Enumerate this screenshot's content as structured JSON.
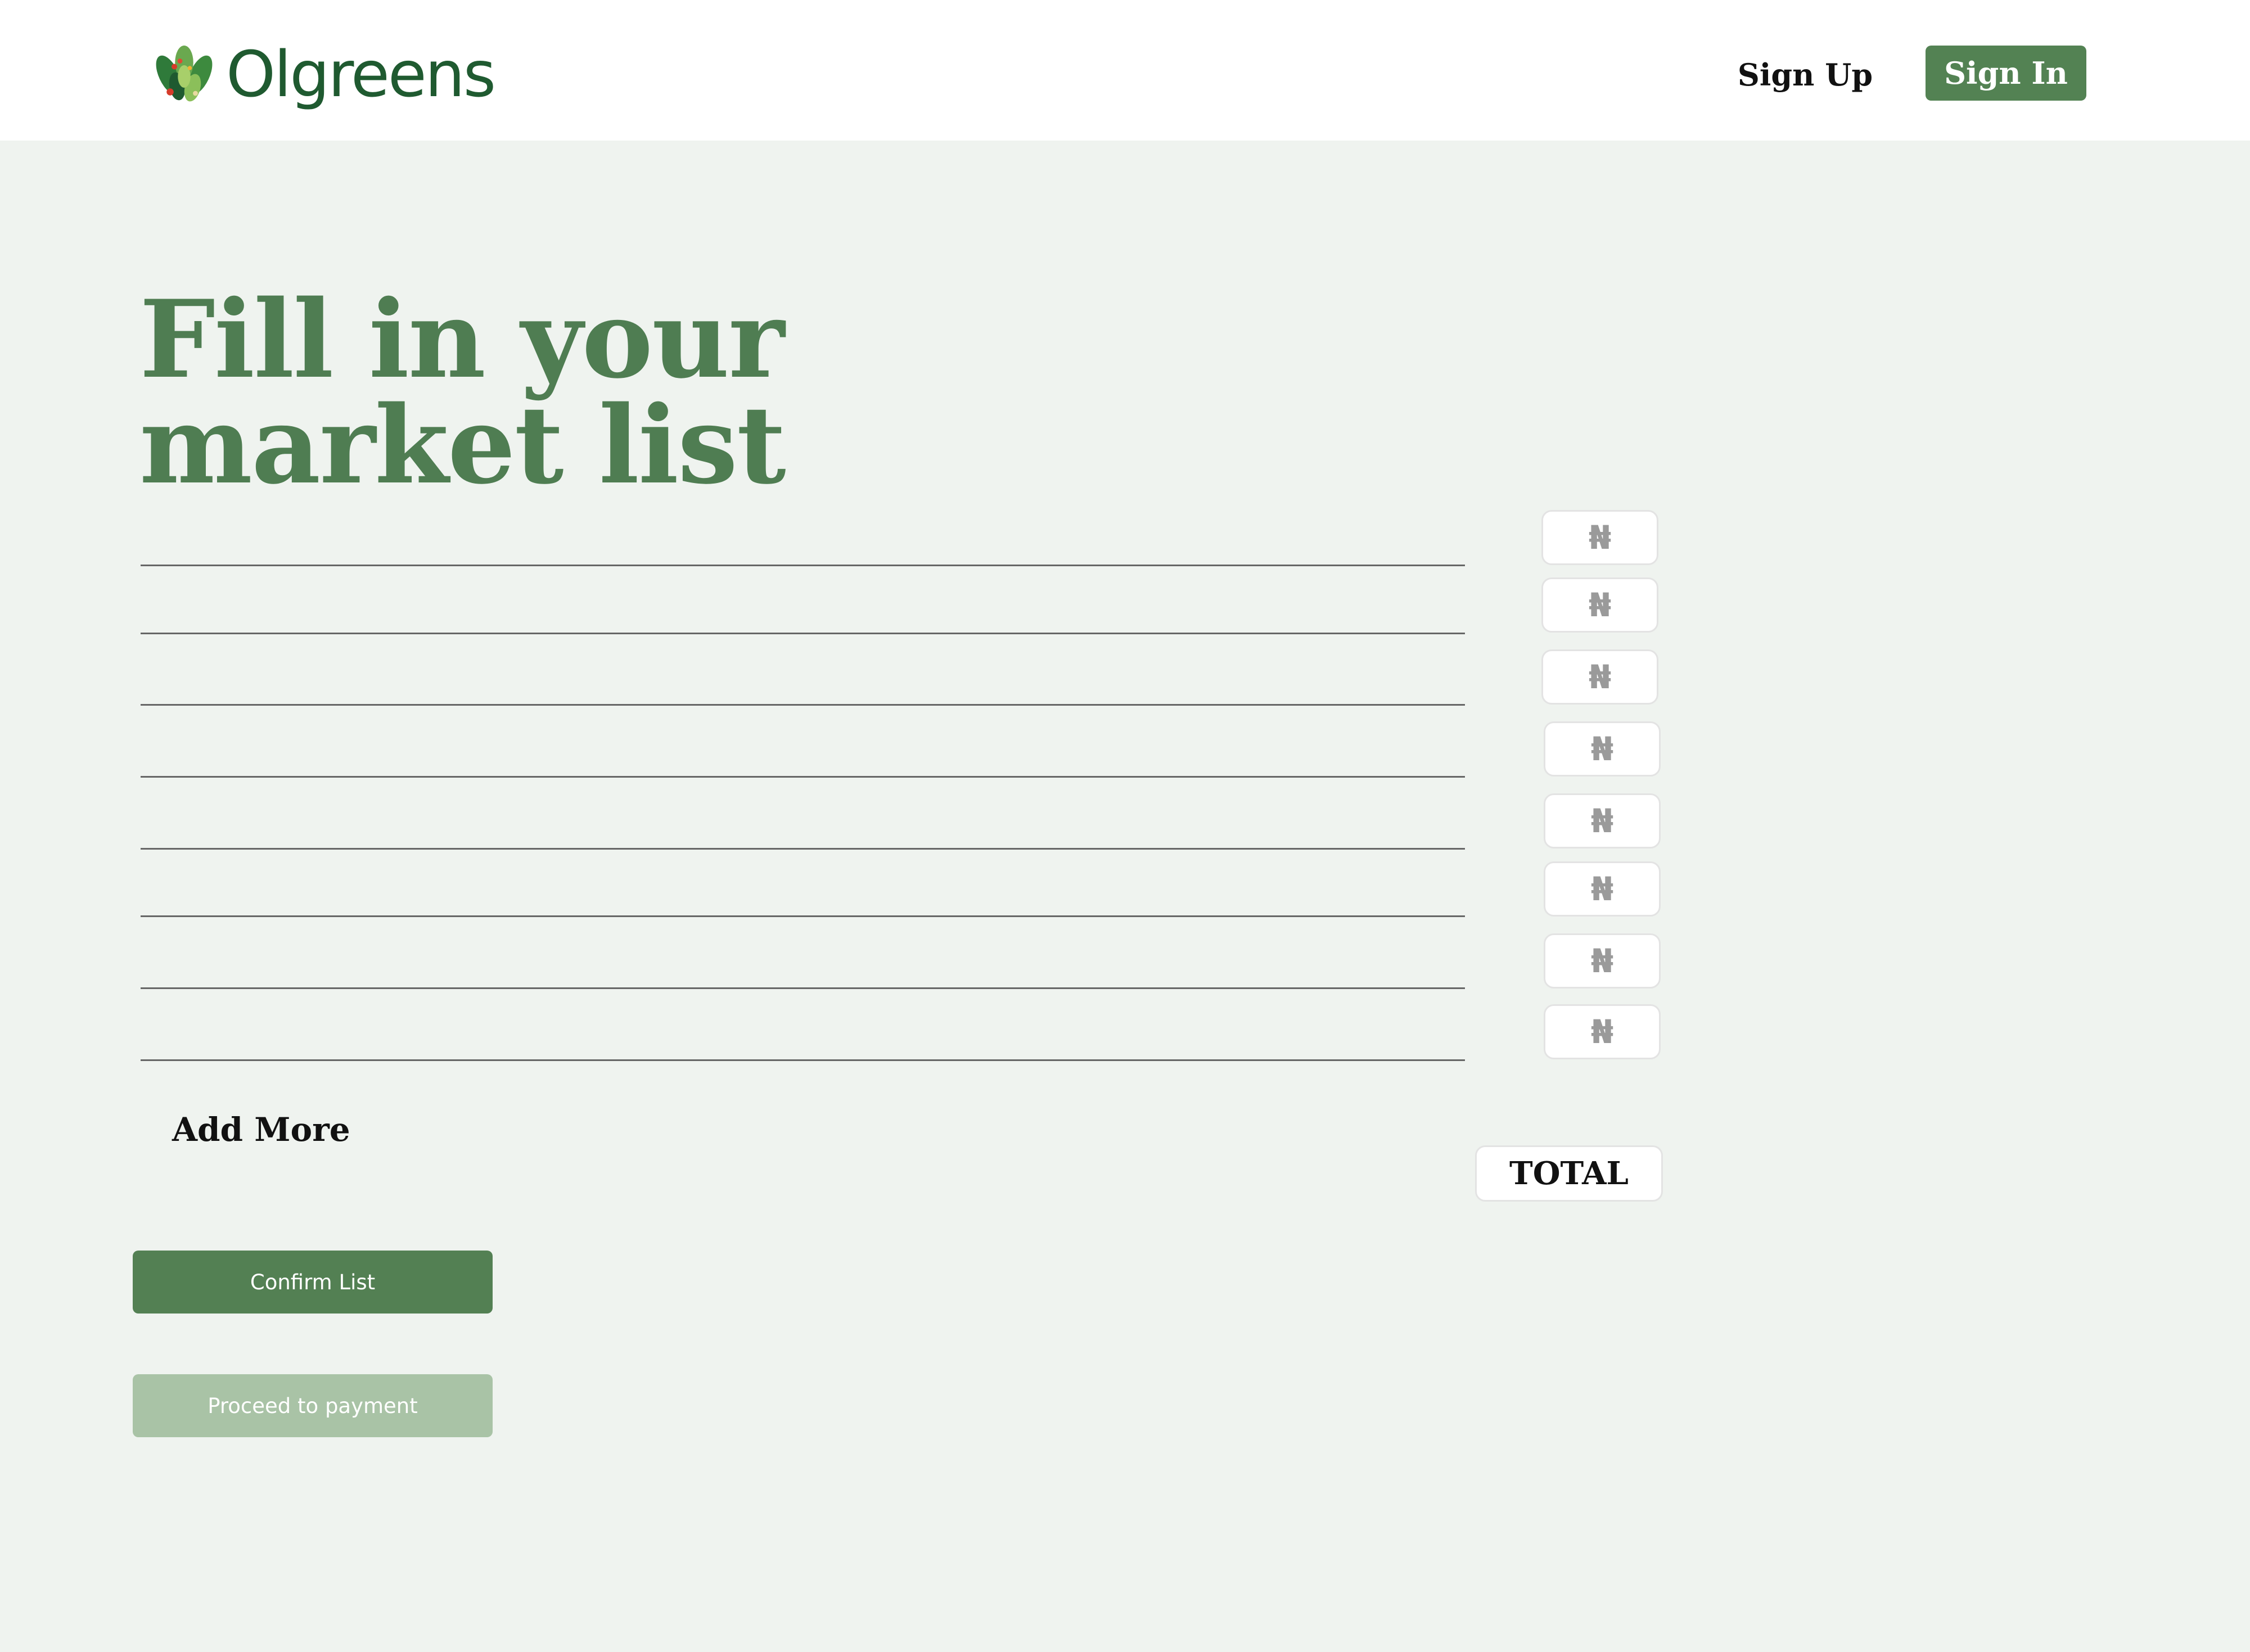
{
  "header": {
    "brand_name": "Olgreens",
    "logo_icon": "leaf-bouquet-icon",
    "signup_label": "Sign Up",
    "signin_label": "Sign In"
  },
  "main": {
    "title_line1": "Fill in your",
    "title_line2": "market list",
    "item_rows": [
      {
        "item": "",
        "price_placeholder": "₦"
      },
      {
        "item": "",
        "price_placeholder": "₦"
      },
      {
        "item": "",
        "price_placeholder": "₦"
      },
      {
        "item": "",
        "price_placeholder": "₦"
      },
      {
        "item": "",
        "price_placeholder": "₦"
      },
      {
        "item": "",
        "price_placeholder": "₦"
      },
      {
        "item": "",
        "price_placeholder": "₦"
      },
      {
        "item": "",
        "price_placeholder": "₦"
      }
    ],
    "add_more_label": "Add More",
    "total_label": "TOTAL",
    "confirm_label": "Confirm List",
    "proceed_label": "Proceed to payment"
  },
  "colors": {
    "brand_dark": "#1f5a30",
    "accent": "#538253",
    "title": "#4f7d52",
    "disabled_button": "#a9c3a6",
    "page_background": "#eff3ef"
  }
}
